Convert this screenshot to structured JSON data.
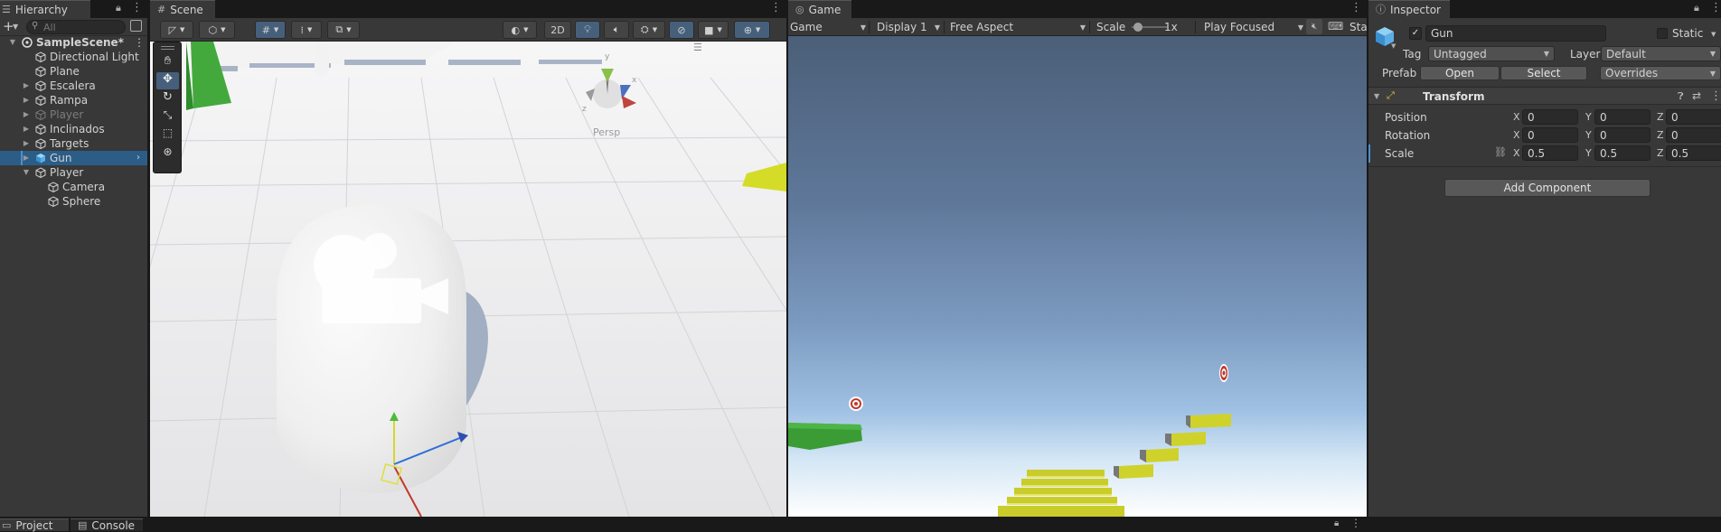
{
  "hierarchy": {
    "tab_label": "Hierarchy",
    "search_placeholder": "All",
    "items": [
      {
        "label": "SampleScene*",
        "depth": 0,
        "fold": "open",
        "kind": "scene"
      },
      {
        "label": "Directional Light",
        "depth": 1,
        "fold": "none",
        "kind": "obj"
      },
      {
        "label": "Plane",
        "depth": 1,
        "fold": "none",
        "kind": "obj"
      },
      {
        "label": "Escalera",
        "depth": 1,
        "fold": "closed",
        "kind": "obj"
      },
      {
        "label": "Rampa",
        "depth": 1,
        "fold": "closed",
        "kind": "obj"
      },
      {
        "label": "Player",
        "depth": 1,
        "fold": "closed",
        "kind": "obj",
        "disabled": true
      },
      {
        "label": "Inclinados",
        "depth": 1,
        "fold": "closed",
        "kind": "obj"
      },
      {
        "label": "Targets",
        "depth": 1,
        "fold": "closed",
        "kind": "obj"
      },
      {
        "label": "Gun",
        "depth": 1,
        "fold": "closed",
        "kind": "prefab",
        "selected": true
      },
      {
        "label": "Player",
        "depth": 1,
        "fold": "open",
        "kind": "obj"
      },
      {
        "label": "Camera",
        "depth": 2,
        "fold": "none",
        "kind": "obj"
      },
      {
        "label": "Sphere",
        "depth": 2,
        "fold": "none",
        "kind": "obj"
      }
    ]
  },
  "scene": {
    "tab_label": "Scene",
    "btn_2d": "2D",
    "persp_label": "Persp",
    "gizmo_axes": {
      "y": "y",
      "x": "x",
      "z": "z"
    }
  },
  "game": {
    "tab_label": "Game",
    "view_dropdown": "Game",
    "display_dropdown": "Display 1",
    "aspect_dropdown": "Free Aspect",
    "scale_label": "Scale",
    "scale_value": "1x",
    "scale_slider_fraction": 0.05,
    "play_mode_dropdown": "Play Focused",
    "stats_label": "Stats"
  },
  "inspector": {
    "tab_label": "Inspector",
    "object_name": "Gun",
    "static_label": "Static",
    "tag_label": "Tag",
    "tag_value": "Untagged",
    "layer_label": "Layer",
    "layer_value": "Default",
    "prefab_label": "Prefab",
    "open_btn": "Open",
    "select_btn": "Select",
    "overrides_btn": "Overrides",
    "component_title": "Transform",
    "rows": [
      {
        "label": "Position",
        "x": "0",
        "y": "0",
        "z": "0"
      },
      {
        "label": "Rotation",
        "x": "0",
        "y": "0",
        "z": "0"
      },
      {
        "label": "Scale",
        "x": "0.5",
        "y": "0.5",
        "z": "0.5"
      }
    ],
    "axis_x": "X",
    "axis_y": "Y",
    "axis_z": "Z",
    "add_component": "Add Component"
  },
  "bottom": {
    "project_tab": "Project",
    "console_tab": "Console"
  },
  "colors": {
    "accent": "#2c5d87",
    "panel": "#383838",
    "bar": "#191919",
    "field": "#2a2a2a"
  }
}
